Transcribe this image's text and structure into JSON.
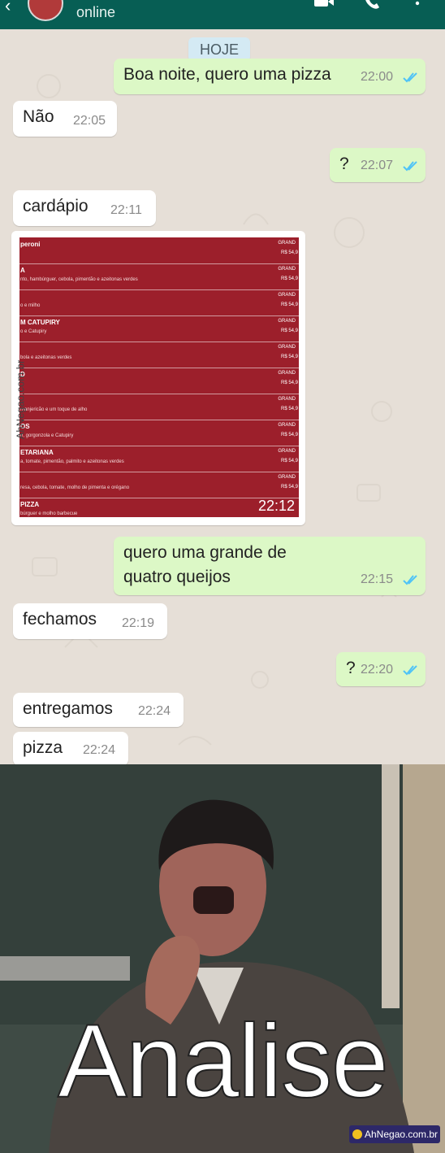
{
  "header": {
    "status": "online",
    "colors": {
      "bar": "#075e54"
    },
    "icons": [
      "back-arrow-icon",
      "avatar",
      "video-call-icon",
      "phone-icon",
      "more-options-icon"
    ]
  },
  "chat": {
    "date_label": "HOJE",
    "messages": [
      {
        "dir": "out",
        "text": "Boa noite, quero uma pizza",
        "time": "22:00",
        "status": "read"
      },
      {
        "dir": "in",
        "text": "Não",
        "time": "22:05"
      },
      {
        "dir": "out",
        "text": "?",
        "time": "22:07",
        "status": "read"
      },
      {
        "dir": "in",
        "text": "cardápio",
        "time": "22:11"
      },
      {
        "dir": "in",
        "type": "image",
        "time": "22:12"
      },
      {
        "dir": "out",
        "lines": [
          "quero uma grande de",
          "quatro queijos"
        ],
        "time": "22:15",
        "status": "read"
      },
      {
        "dir": "in",
        "text": "fechamos",
        "time": "22:19"
      },
      {
        "dir": "out",
        "text": "?",
        "time": "22:20",
        "status": "read"
      },
      {
        "dir": "in",
        "text": "entregamos",
        "time": "22:24"
      },
      {
        "dir": "in",
        "text": "pizza",
        "time": "22:24"
      }
    ],
    "colors": {
      "outgoing": "#dcf8c6",
      "incoming": "#ffffff",
      "read_tick": "#4fc3f7"
    }
  },
  "menu_image": {
    "items": [
      {
        "name": "peroni",
        "desc": "",
        "size": "GRAND",
        "price": "R$ 54,9"
      },
      {
        "name": "A",
        "desc": "nto, hambúrguer, cebola, pimentão e azeitonas verdes",
        "size": "GRAND",
        "price": "R$ 54,9"
      },
      {
        "name": "",
        "desc": "o e milho",
        "size": "GRAND",
        "price": "R$ 54,9"
      },
      {
        "name": "M CATUPIRY",
        "desc": "o e Catupiry",
        "size": "GRAND",
        "price": "R$ 54,9"
      },
      {
        "name": "",
        "desc": "bola e azeitonas verdes",
        "size": "GRAND",
        "price": "R$ 54,9"
      },
      {
        "name": "D",
        "desc": "",
        "size": "GRAND",
        "price": "R$ 54,9"
      },
      {
        "name": "",
        "desc": "manjericão e um toque de alho",
        "size": "GRAND",
        "price": "R$ 54,9"
      },
      {
        "name": "OS",
        "desc": "e, gorgonzola e Catupiry",
        "size": "GRAND",
        "price": "R$ 54,9"
      },
      {
        "name": "ETARIANA",
        "desc": "a, tomate, pimentão, palmito e azeitonas verdes",
        "size": "GRAND",
        "price": "R$ 54,9"
      },
      {
        "name": "",
        "desc": "resa, cebola, tomate, molho de pimenta e orégano",
        "size": "GRAND",
        "price": "R$ 54,9"
      },
      {
        "name": "PIZZA",
        "desc": "búrguer e molho barbecue",
        "size": "",
        "price": ""
      }
    ],
    "side_watermark": "AhNegao.com.br"
  },
  "meme": {
    "caption": "Analise",
    "watermark": "AhNegao.com.br"
  }
}
